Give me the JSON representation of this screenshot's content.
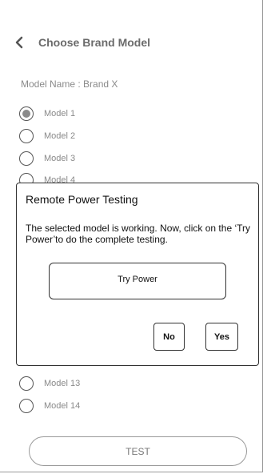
{
  "header": {
    "title": "Choose Brand Model",
    "back_icon": "chevron-left-icon"
  },
  "model_name": "Model Name : Brand X",
  "models": [
    {
      "label": "Model 1",
      "selected": true
    },
    {
      "label": "Model 2",
      "selected": false
    },
    {
      "label": "Model 3",
      "selected": false
    },
    {
      "label": "Model 4",
      "selected": false
    },
    {
      "label": "Model 13",
      "selected": false
    },
    {
      "label": "Model 14",
      "selected": false
    }
  ],
  "dialog": {
    "title": "Remote Power Testing",
    "message": "The selected model is working. Now, click on the ‘Try Power’to do the complete testing.",
    "try_label": "Try Power",
    "no_label": "No",
    "yes_label": "Yes"
  },
  "test_label": "TEST",
  "colors": {
    "accent": "#8a8a8a",
    "border": "#333333"
  }
}
